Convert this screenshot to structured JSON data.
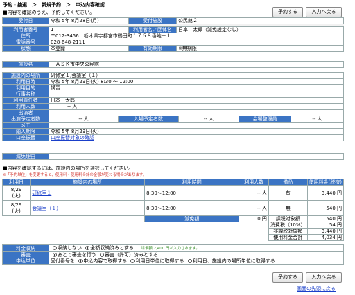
{
  "breadcrumb": "予約・抽選　＞　新規予約　＞　申込内容確認",
  "instruction": "■内容を確認のうえ、予約してください。",
  "buttons": {
    "reserve": "予約する",
    "back": "入力へ戻る"
  },
  "summary": {
    "accept_date_label": "受付日",
    "accept_date": "令和 5年 8月28日(月)",
    "accept_facility_label": "受付施設",
    "accept_facility": "公民館２",
    "user_no_label": "利用者番号",
    "user_no": "1",
    "user_name_label": "利用者名／団体名",
    "user_name": "日本　太郎（減免設定なし）",
    "address_label": "住所",
    "address": "〒012-3456　栃木県宇都宮市鶴田町１７５８番地－１",
    "phone_label": "電話番号",
    "phone": "028-648-2111",
    "status_label": "状態",
    "status": "本登録",
    "expiry_label": "有効期限",
    "expiry": "※無期限"
  },
  "facility": {
    "label": "施設名",
    "name": "ＴＡＳＫ市中央公民館"
  },
  "details": {
    "place_label": "施設内の場所",
    "place": "研修室１,会議室（１）",
    "datetime_label": "利用日時",
    "datetime": "令和 5年 8月29日(火)  8:30 ～ 12:00",
    "purpose_label": "利用目的",
    "purpose": "講習",
    "event_label": "行事名称",
    "event": "",
    "manager_label": "利用責任者",
    "manager": "日本　太郎",
    "people_label": "利用人数",
    "people": "-- 人",
    "performer_label": "出演者",
    "performer": "",
    "performer_count_label": "出演予定者数",
    "performer_count": "-- 人",
    "visitors_label": "入場予定者数",
    "visitors": "-- 人",
    "staff_label": "会場整理員",
    "staff": "-- 人",
    "memo_label": "メモ",
    "memo": "",
    "deposit_label": "納入期限",
    "deposit": "令和 5年 8月29日(火)",
    "account_label": "口座振替",
    "account_link": "口座振替対象の確認"
  },
  "reduction": {
    "label": "減免理由",
    "value": ""
  },
  "notes": {
    "line1": "■内容を確認するには、施設内の場所を選択してください。",
    "line2": "※「予約単位」を変更すると、使用料・使用料合計の金額が変わる場合があります。"
  },
  "fee_table": {
    "headers": [
      "利用日",
      "施設内の場所",
      "利用時間",
      "利用人数",
      "備品",
      "使用料金(税抜)"
    ],
    "rows": [
      {
        "date": "8/29",
        "dow": "(火)",
        "place": "研修室１",
        "time": "8:30～12:00",
        "people": "-- 人",
        "equip": "有",
        "fee": "3,440 円"
      },
      {
        "date": "8/29",
        "dow": "(火)",
        "place": "会議室（１）",
        "time": "8:30～12:00",
        "people": "-- 人",
        "equip": "無",
        "fee": "540 円"
      }
    ],
    "reduction_label": "減免額",
    "reduction_value": "0 円",
    "taxable_label": "課税対象額",
    "taxable_value": "540 円",
    "tax_label": "消費税（10%）",
    "tax_value": "54 円",
    "nontax_label": "非課税対象額",
    "nontax_value": "3,440 円",
    "total_label": "使用料金合計",
    "total_value": "4,034 円"
  },
  "options": {
    "payment_label": "料金収納",
    "payment_opt1": "収納しない",
    "payment_opt2": "全額収納済みとする",
    "payment_note": "請求額 2,400 円が入力されます。",
    "review_label": "審査",
    "review_opt1": "あとで審査を行う",
    "review_opt2": "審査（許可）済みとする",
    "unit_label": "申込単位",
    "unit_prefix": "受付番号を",
    "unit_opt1": "申込内容で取得する",
    "unit_opt2": "利用日単位に取得する",
    "unit_opt3": "利用日、施設内の場所単位に取得する"
  },
  "footer_link": "画面の先頭に戻る"
}
